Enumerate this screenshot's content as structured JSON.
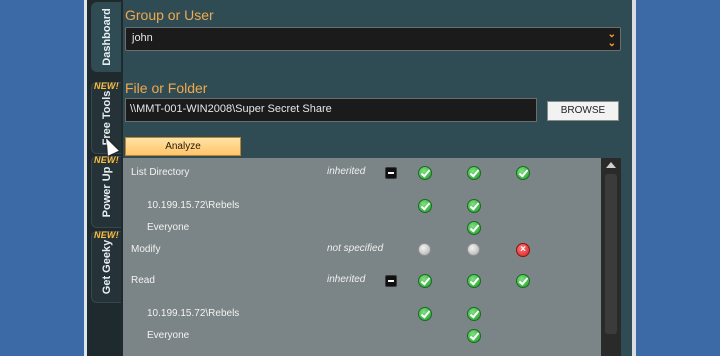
{
  "sidebar": {
    "tabs": [
      {
        "label": "Dashboard",
        "badge": ""
      },
      {
        "label": "Free Tools",
        "badge": "NEW!"
      },
      {
        "label": "Power Up",
        "badge": "NEW!"
      },
      {
        "label": "Get Geeky",
        "badge": "NEW!"
      }
    ]
  },
  "group_user": {
    "label": "Group or User",
    "value": "john"
  },
  "file_folder": {
    "label": "File or Folder",
    "path": "\\\\MMT-001-WIN2008\\Super Secret Share",
    "browse_label": "BROWSE"
  },
  "analyze_label": "Analyze",
  "permissions": {
    "rows": [
      {
        "name": "List Directory",
        "source": "inherited",
        "indent": false,
        "collapse": true,
        "icons": [
          "check",
          "check",
          "check"
        ]
      },
      {
        "name": "10.199.15.72\\Rebels",
        "source": "",
        "indent": true,
        "collapse": false,
        "icons": [
          "check",
          "check",
          ""
        ]
      },
      {
        "name": "Everyone",
        "source": "",
        "indent": true,
        "collapse": false,
        "icons": [
          "",
          "check",
          ""
        ]
      },
      {
        "name": "Modify",
        "source": "not specified",
        "indent": false,
        "collapse": false,
        "icons": [
          "gray",
          "gray",
          "deny"
        ]
      },
      {
        "name": "Read",
        "source": "inherited",
        "indent": false,
        "collapse": true,
        "icons": [
          "check",
          "check",
          "check"
        ]
      },
      {
        "name": "10.199.15.72\\Rebels",
        "source": "",
        "indent": true,
        "collapse": false,
        "icons": [
          "check",
          "check",
          ""
        ]
      },
      {
        "name": "Everyone",
        "source": "",
        "indent": true,
        "collapse": false,
        "icons": [
          "",
          "check",
          ""
        ]
      }
    ]
  },
  "colors": {
    "accent": "#f2a84b",
    "grant": "#1f9c2a",
    "deny": "#d21f1f"
  }
}
